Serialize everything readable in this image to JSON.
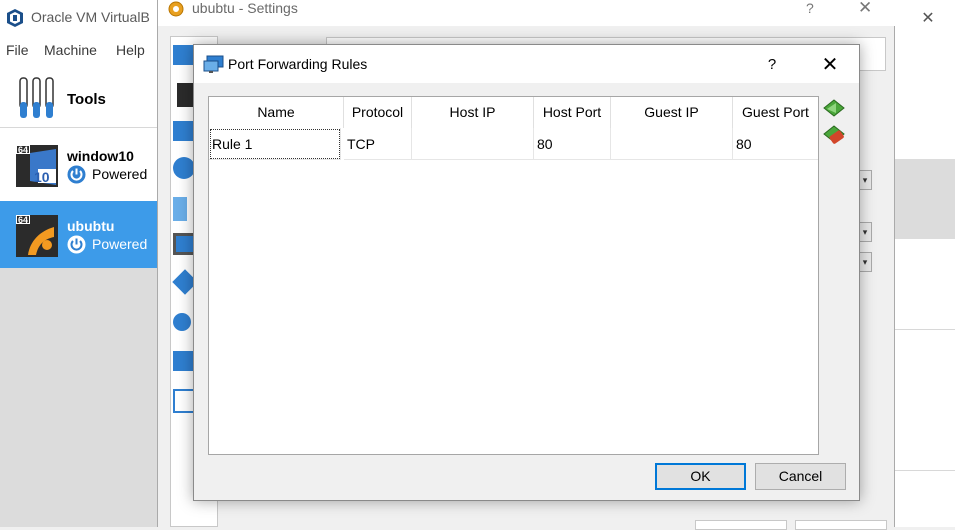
{
  "manager": {
    "title": "Oracle VM VirtualB",
    "menu": [
      "File",
      "Machine",
      "Help"
    ],
    "tools_label": "Tools",
    "vms": [
      {
        "name": "window10",
        "state": "Powered",
        "os_badge": "64",
        "os_num": "10"
      },
      {
        "name": "ububtu",
        "state": "Powered",
        "os_badge": "64"
      }
    ]
  },
  "settings": {
    "title": "ububtu - Settings",
    "help": "?"
  },
  "dialog": {
    "title": "Port Forwarding Rules",
    "help": "?",
    "columns": [
      "Name",
      "Protocol",
      "Host IP",
      "Host Port",
      "Guest IP",
      "Guest Port"
    ],
    "rows": [
      {
        "name": "Rule 1",
        "protocol": "TCP",
        "host_ip": "",
        "host_port": "80",
        "guest_ip": "",
        "guest_port": "80"
      }
    ],
    "ok_label": "OK",
    "cancel_label": "Cancel"
  },
  "colors": {
    "selection": "#3d9be9",
    "accent_border": "#0078d7",
    "add_icon": "#3a9a2a",
    "remove_icon": "#d2462a"
  },
  "icons": [
    "vbox-logo-icon",
    "tools-icon",
    "power-icon",
    "settings-gear-icon",
    "network-icon",
    "add-rule-icon",
    "remove-rule-icon"
  ]
}
